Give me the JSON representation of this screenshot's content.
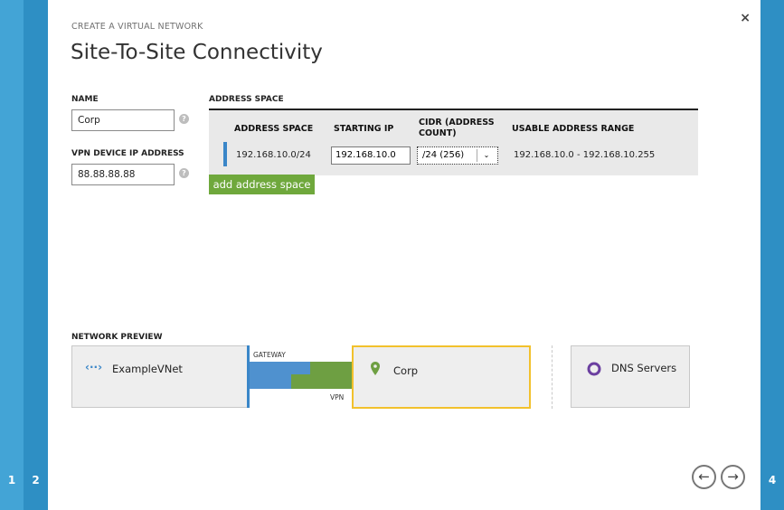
{
  "wizard": {
    "caption": "CREATE A VIRTUAL NETWORK",
    "title": "Site-To-Site Connectivity",
    "close_label": "×",
    "steps": [
      {
        "label": "1"
      },
      {
        "label": "2"
      },
      {
        "label": "4"
      }
    ]
  },
  "form": {
    "name_label": "NAME",
    "name_value": "Corp",
    "vpn_label": "VPN DEVICE IP ADDRESS",
    "vpn_value": "88.88.88.88",
    "help_glyph": "?"
  },
  "address_space": {
    "section_label": "ADDRESS SPACE",
    "columns": [
      "ADDRESS SPACE",
      "STARTING IP",
      "CIDR (ADDRESS COUNT)",
      "USABLE ADDRESS RANGE"
    ],
    "rows": [
      {
        "address_space": "192.168.10.0/24",
        "starting_ip": "192.168.10.0",
        "cidr": "/24 (256)",
        "usable_range": "192.168.10.0 - 192.168.10.255"
      }
    ],
    "dropdown_glyph": "⌄",
    "add_button": "add address space"
  },
  "preview": {
    "label": "NETWORK PREVIEW",
    "vnet": {
      "name": "ExampleVNet",
      "icon": "vnet-arrows-icon",
      "glyph": "‹··›"
    },
    "gateway_label": "GATEWAY",
    "vpn_label": "VPN",
    "corp": {
      "name": "Corp",
      "icon": "location-pin-icon"
    },
    "dns": {
      "name": "DNS Servers",
      "icon": "dns-ring-icon"
    }
  },
  "nav": {
    "back_glyph": "←",
    "next_glyph": "→"
  },
  "colors": {
    "accent_blue": "#2e8fc4",
    "green": "#6fa83c",
    "gold": "#f2c12c",
    "purple": "#6b3fa0"
  }
}
